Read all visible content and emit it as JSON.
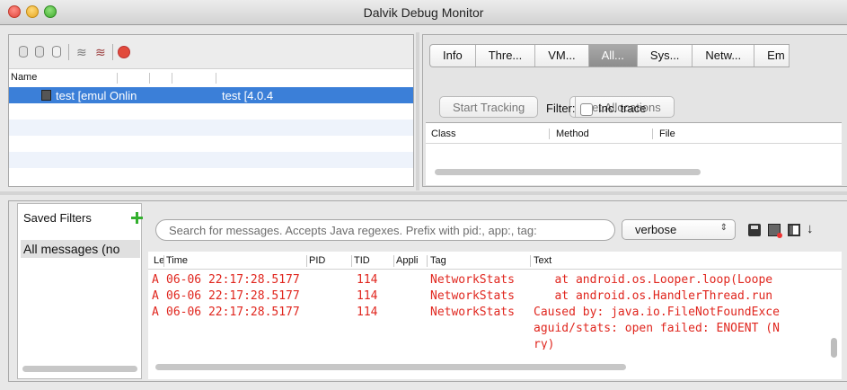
{
  "window": {
    "title": "Dalvik Debug Monitor"
  },
  "devices": {
    "columns": [
      "Name"
    ],
    "rows": [
      {
        "name": "test [emul Onlin",
        "target": "test [4.0.4"
      }
    ]
  },
  "tabs": [
    "Info",
    "Thre...",
    "VM...",
    "All...",
    "Sys...",
    "Netw...",
    "Em"
  ],
  "active_tab": "All...",
  "allocation": {
    "start_tracking": "Start Tracking",
    "get_allocations": "Get Allocations",
    "filter_label": "Filter:",
    "inc_trace_label": "Inc. trace",
    "columns": [
      "Class",
      "Method",
      "File"
    ]
  },
  "saved_filters": {
    "title": "Saved Filters",
    "items": [
      "All messages (no"
    ]
  },
  "logcat": {
    "search_placeholder": "Search for messages. Accepts Java regexes. Prefix with pid:, app:, tag:",
    "level": "verbose",
    "columns": [
      "Le",
      "Time",
      "PID",
      "TID",
      "Appli",
      "Tag",
      "Text"
    ],
    "rows": [
      {
        "level": "A",
        "time": "06-06 22:17:28.5177",
        "pid": "114",
        "tid": "",
        "app": "",
        "tag": "NetworkStats",
        "text": "   at android.os.Looper.loop(Loope"
      },
      {
        "level": "A",
        "time": "06-06 22:17:28.5177",
        "pid": "114",
        "tid": "",
        "app": "",
        "tag": "NetworkStats",
        "text": "   at android.os.HandlerThread.run"
      },
      {
        "level": "A",
        "time": "06-06 22:17:28.5177",
        "pid": "114",
        "tid": "",
        "app": "",
        "tag": "NetworkStats",
        "text": "Caused by: java.io.FileNotFoundExce"
      },
      {
        "level": "",
        "time": "",
        "pid": "",
        "tid": "",
        "app": "",
        "tag": "",
        "text": "aguid/stats: open failed: ENOENT (N"
      },
      {
        "level": "",
        "time": "",
        "pid": "",
        "tid": "",
        "app": "",
        "tag": "",
        "text": "ry)"
      }
    ]
  },
  "colors": {
    "selection": "#3b7fd8",
    "log_text": "#e0261e",
    "active_tab": "#959595"
  },
  "icons": [
    "database-icon",
    "database-update-icon",
    "database-gc-icon",
    "thread-icon",
    "thread-update-icon",
    "stop-icon",
    "add-filter-icon",
    "save-icon",
    "clear-log-icon",
    "toggle-panel-icon",
    "scroll-lock-icon"
  ]
}
